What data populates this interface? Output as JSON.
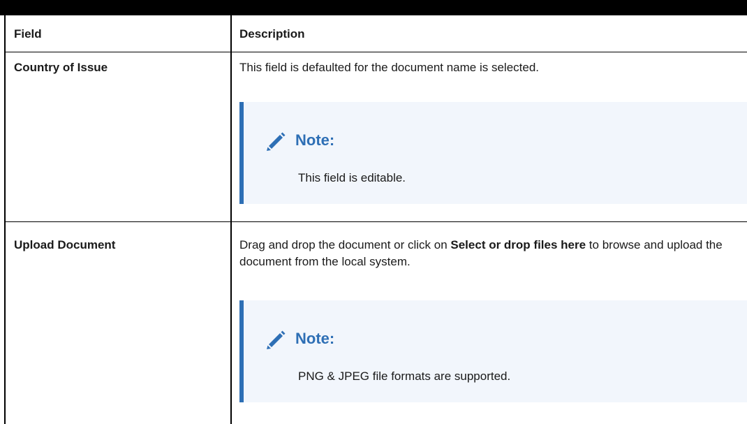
{
  "table": {
    "headers": {
      "field": "Field",
      "description": "Description"
    },
    "rows": [
      {
        "field": "Country of Issue",
        "description": "This field is defaulted for the document name is selected.",
        "note": {
          "title": "Note:",
          "text": "This field is editable.",
          "icon": "pencil-icon"
        }
      },
      {
        "field": "Upload Document",
        "description_pre": "Drag and drop the document or click on ",
        "description_bold": "Select or drop files here",
        "description_post": " to browse and upload the document from the local system.",
        "note": {
          "title": "Note:",
          "text": "PNG & JPEG file formats are supported.",
          "icon": "pencil-icon"
        }
      }
    ]
  },
  "colors": {
    "note_accent": "#2e6fb5",
    "note_background": "#f2f6fc"
  }
}
